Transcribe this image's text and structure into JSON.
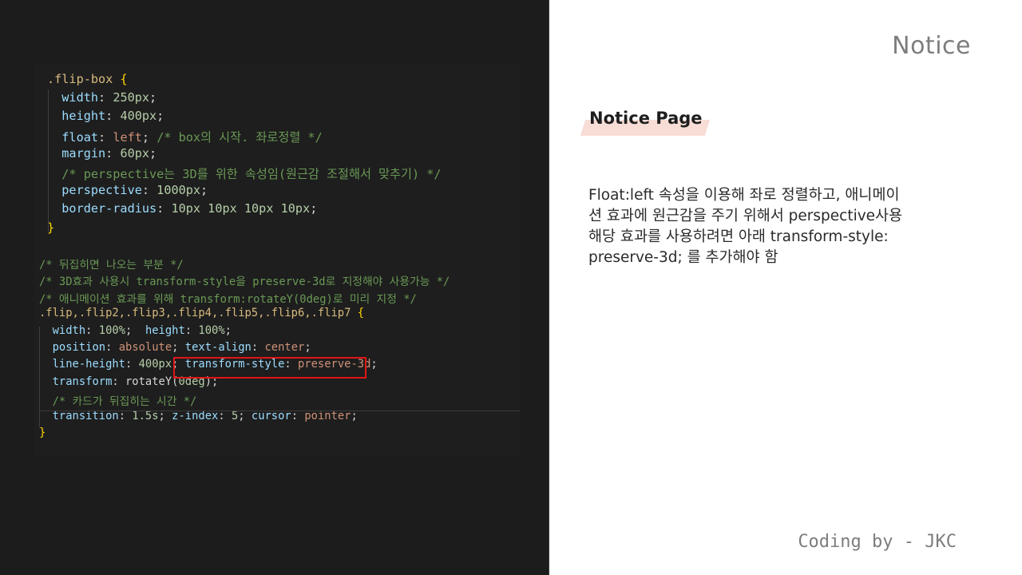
{
  "code_block_1": [
    [
      [
        "sel",
        ".flip-box "
      ],
      [
        "brace",
        "{"
      ]
    ],
    [
      [
        "prop",
        "  width"
      ],
      [
        "plain",
        ": "
      ],
      [
        "num",
        "250px"
      ],
      [
        "plain",
        ";"
      ]
    ],
    [
      [
        "prop",
        "  height"
      ],
      [
        "plain",
        ": "
      ],
      [
        "num",
        "400px"
      ],
      [
        "plain",
        ";"
      ]
    ],
    [
      [
        "prop",
        "  float"
      ],
      [
        "plain",
        ": "
      ],
      [
        "str",
        "left"
      ],
      [
        "plain",
        "; "
      ],
      [
        "cmt",
        "/* box의 시작. 좌로정렬 */"
      ]
    ],
    [
      [
        "prop",
        "  margin"
      ],
      [
        "plain",
        ": "
      ],
      [
        "num",
        "60px"
      ],
      [
        "plain",
        ";"
      ]
    ],
    [
      [
        "cmt",
        "  /* perspective는 3D를 위한 속성임(원근감 조절해서 맞추기) */"
      ]
    ],
    [
      [
        "prop",
        "  perspective"
      ],
      [
        "plain",
        ": "
      ],
      [
        "num",
        "1000px"
      ],
      [
        "plain",
        ";"
      ]
    ],
    [
      [
        "prop",
        "  border-radius"
      ],
      [
        "plain",
        ": "
      ],
      [
        "num",
        "10px 10px 10px 10px"
      ],
      [
        "plain",
        ";"
      ]
    ],
    [
      [
        "brace",
        "}"
      ]
    ]
  ],
  "code_block_2": [
    [
      [
        "cmt",
        "/* 뒤집히면 나오는 부분 */"
      ]
    ],
    [
      [
        "cmt",
        "/* 3D효과 사용시 transform-style을 preserve-3d로 지정해야 사용가능 */"
      ]
    ],
    [
      [
        "cmt",
        "/* 애니메이션 효과를 위해 transform:rotateY(0deg)로 미리 지정 */"
      ]
    ],
    [
      [
        "sel",
        ".flip,.flip2,.flip3,.flip4,.flip5,.flip6,.flip7 "
      ],
      [
        "brace",
        "{"
      ]
    ],
    [
      [
        "prop",
        "  width"
      ],
      [
        "plain",
        ": "
      ],
      [
        "num",
        "100%"
      ],
      [
        "plain",
        ";  "
      ],
      [
        "prop",
        "height"
      ],
      [
        "plain",
        ": "
      ],
      [
        "num",
        "100%"
      ],
      [
        "plain",
        ";"
      ]
    ],
    [
      [
        "prop",
        "  position"
      ],
      [
        "plain",
        ": "
      ],
      [
        "str",
        "absolute"
      ],
      [
        "plain",
        "; "
      ],
      [
        "prop",
        "text-align"
      ],
      [
        "plain",
        ": "
      ],
      [
        "str",
        "center"
      ],
      [
        "plain",
        ";"
      ]
    ],
    [
      [
        "prop",
        "  line-height"
      ],
      [
        "plain",
        ": "
      ],
      [
        "num",
        "400px"
      ],
      [
        "plain",
        "; "
      ],
      [
        "prop",
        "transform-style"
      ],
      [
        "plain",
        ": "
      ],
      [
        "str",
        "preserve-3d"
      ],
      [
        "plain",
        ";"
      ]
    ],
    [
      [
        "prop",
        "  transform"
      ],
      [
        "plain",
        ": "
      ],
      [
        "plain",
        "rotateY("
      ],
      [
        "num",
        "0deg"
      ],
      [
        "plain",
        ");"
      ]
    ],
    [
      [
        "cmt",
        "  /* 카드가 뒤집히는 시간 */"
      ]
    ],
    [
      [
        "prop",
        "  transition"
      ],
      [
        "plain",
        ": "
      ],
      [
        "num",
        "1.5s"
      ],
      [
        "plain",
        "; "
      ],
      [
        "prop",
        "z-index"
      ],
      [
        "plain",
        ": "
      ],
      [
        "num",
        "5"
      ],
      [
        "plain",
        "; "
      ],
      [
        "prop",
        "cursor"
      ],
      [
        "plain",
        ": "
      ],
      [
        "str",
        "pointer"
      ],
      [
        "plain",
        ";"
      ]
    ],
    [
      [
        "brace",
        "}"
      ]
    ]
  ],
  "notice_title": "Notice",
  "page_tag": "Notice Page",
  "description_lines": [
    "Float:left 속성을 이용해 좌로 정렬하고, 애니메이",
    "션 효과에 원근감을 주기 위해서 perspective사용",
    "해당 효과를 사용하려면 아래 transform-style:",
    "preserve-3d; 를 추가해야 함"
  ],
  "footer": "Coding by - JKC",
  "colors": {
    "accent_tag_bg": "#f7ddd6",
    "highlight_box": "#e01616",
    "editor_bg": "#1e1e1e"
  }
}
